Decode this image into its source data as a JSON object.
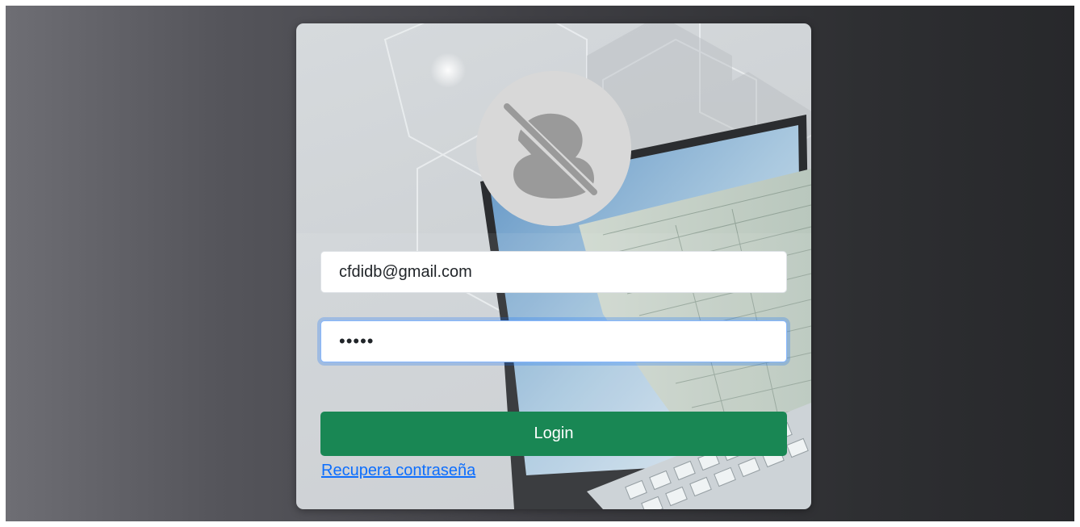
{
  "login_form": {
    "email_value": "cfdidb@gmail.com",
    "password_value": "•••••",
    "login_label": "Login",
    "recover_label": "Recupera contraseña"
  },
  "colors": {
    "login_button": "#198754",
    "link": "#0d6efd",
    "focus_ring": "#86b7fe"
  },
  "icons": {
    "avatar": "user-avatar-icon",
    "background": "invoice-laptop-illustration"
  }
}
